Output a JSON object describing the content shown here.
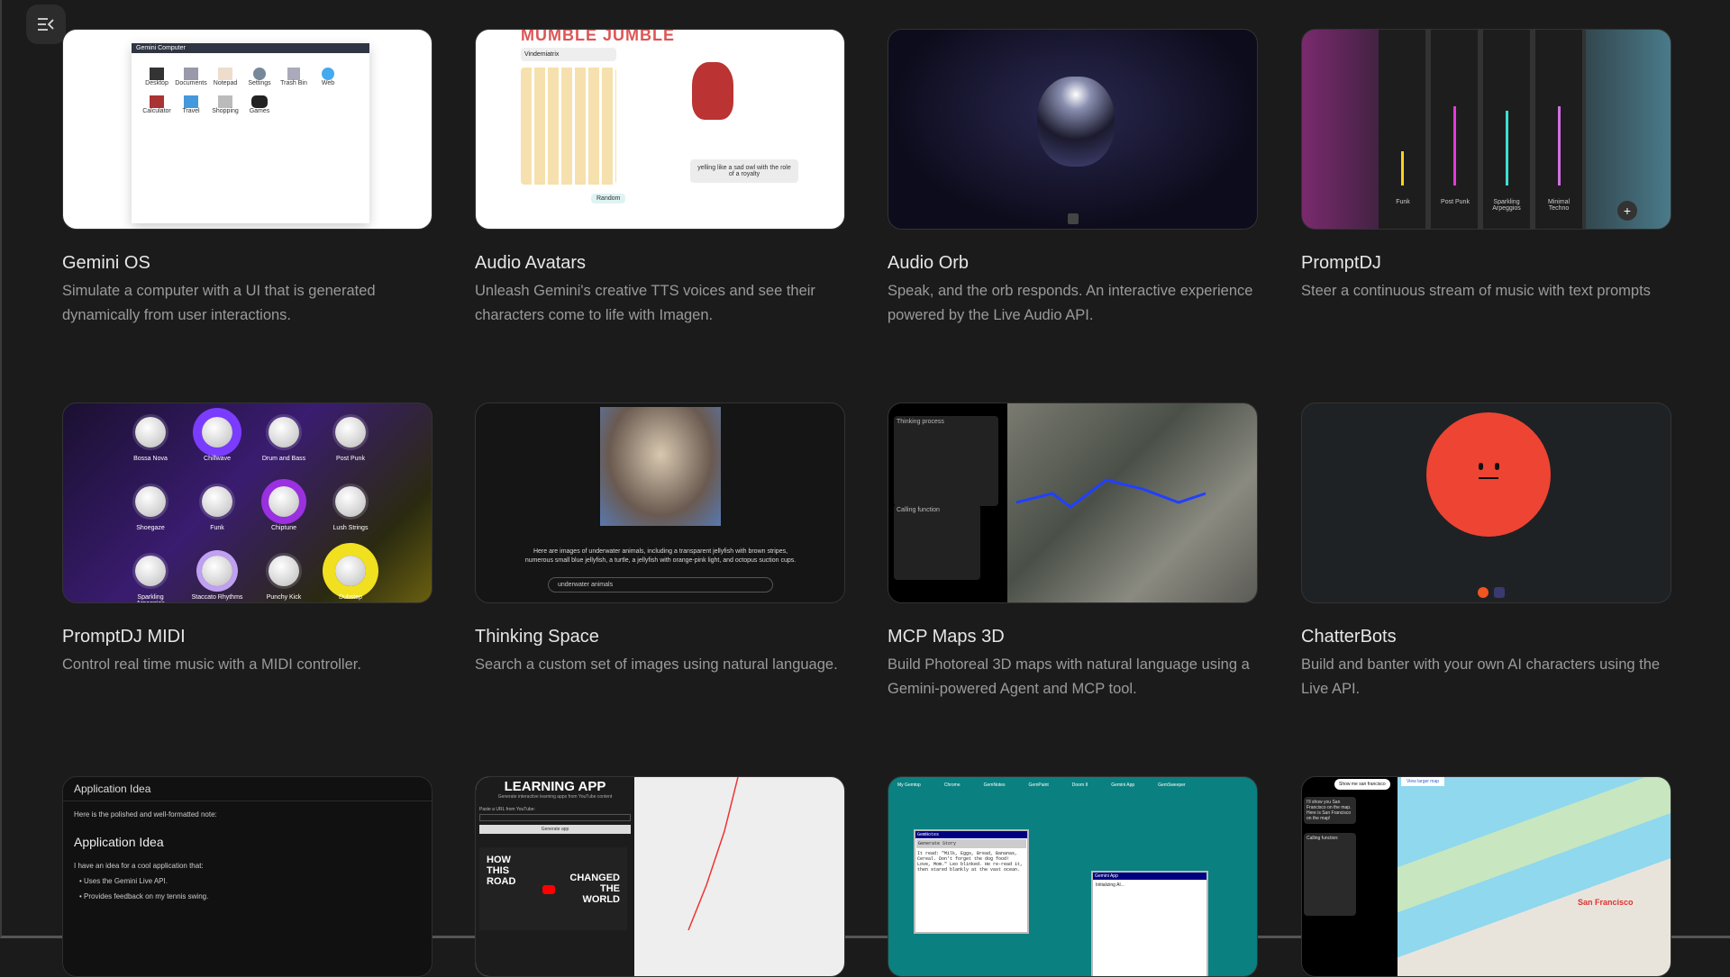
{
  "menu_icon": "sidebar-toggle-icon",
  "cards": [
    {
      "title": "Gemini OS",
      "description": "Simulate a computer with a UI that is generated dynamically from user interactions.",
      "thumb": {
        "window_title": "Gemini Computer",
        "icons": [
          "Desktop",
          "Documents",
          "Notepad",
          "Settings",
          "Trash Bin",
          "Web",
          "Calculator",
          "Travel",
          "Shopping",
          "Games"
        ]
      }
    },
    {
      "title": "Audio Avatars",
      "description": "Unleash Gemini's creative TTS voices and see their characters come to life with Imagen.",
      "thumb": {
        "logo": "MUMBLE JUMBLE",
        "voice": "Vindemiatrix",
        "caption": "yelling like a sad owl with the role of a royalty",
        "random": "Random"
      }
    },
    {
      "title": "Audio Orb",
      "description": "Speak, and the orb responds. An interactive experience powered by the Live Audio API."
    },
    {
      "title": "PromptDJ",
      "description": "Steer a continuous stream of music with text prompts",
      "thumb": {
        "tracks": [
          "Funk",
          "Post Punk",
          "Sparkling Arpeggios",
          "Minimal Techno"
        ]
      }
    },
    {
      "title": "PromptDJ MIDI",
      "description": "Control real time music with a MIDI controller.",
      "thumb": {
        "knobs": [
          "Bossa Nova",
          "Chillwave",
          "Drum and Bass",
          "Post Punk",
          "Shoegaze",
          "Funk",
          "Chiptune",
          "Lush Strings",
          "Sparkling Arpeggios",
          "Staccato Rhythms",
          "Punchy Kick",
          "Dubstep"
        ]
      }
    },
    {
      "title": "Thinking Space",
      "description": "Search a custom set of images using natural language.",
      "thumb": {
        "caption": "Here are images of underwater animals, including a transparent jellyfish with brown stripes, numerous small blue jellyfish, a turtle, a jellyfish with orange-pink light, and octopus suction cups.",
        "query": "underwater animals"
      }
    },
    {
      "title": "MCP Maps 3D",
      "description": "Build Photoreal 3D maps with natural language using a Gemini-powered Agent and MCP tool.",
      "thumb": {
        "panel1": "Thinking process",
        "panel2": "Calling function"
      }
    },
    {
      "title": "ChatterBots",
      "description": "Build and banter with your own AI characters using the Live API."
    },
    {
      "title": "",
      "description": "",
      "thumb": {
        "header": "Application Idea",
        "intro": "Here is the polished and well-formatted note:",
        "heading": "Application Idea",
        "body": "I have an idea for a cool application that:",
        "bullets": [
          "Uses the Gemini Live API.",
          "Provides feedback on my tennis swing."
        ]
      }
    },
    {
      "title": "",
      "description": "",
      "thumb": {
        "logo": "LEARNING APP",
        "subtitle": "Generate interactive learning apps from YouTube content",
        "paste": "Paste a URL from YouTube:",
        "button": "Generate app",
        "video_left": "HOW THIS ROAD",
        "video_right": "CHANGED THE WORLD"
      }
    },
    {
      "title": "",
      "description": "",
      "thumb": {
        "icons": [
          "My Gemtop",
          "Chrome",
          "GemNotes",
          "GemPaint",
          "Doom II",
          "Gemini App",
          "GemSweeper"
        ],
        "window1": "GemNotes",
        "window1_button": "Generate Story",
        "window1_text": "It read: \"Milk, Eggs, Bread, Bananas, Cereal. Don't forget the dog food! Love, Mom.\" Leo blinked. He re-read it, then stared blankly at the vast ocean.",
        "window2": "Gemini App",
        "window2_text": "Initializing AI..."
      }
    },
    {
      "title": "",
      "description": "",
      "thumb": {
        "user_msg": "Show me san francisco",
        "reply": "I'll show you San Francisco on the map. Here is San Francisco on the map!",
        "calling": "Calling function:",
        "map_label": "San Francisco",
        "larger_map": "View larger map"
      }
    }
  ]
}
